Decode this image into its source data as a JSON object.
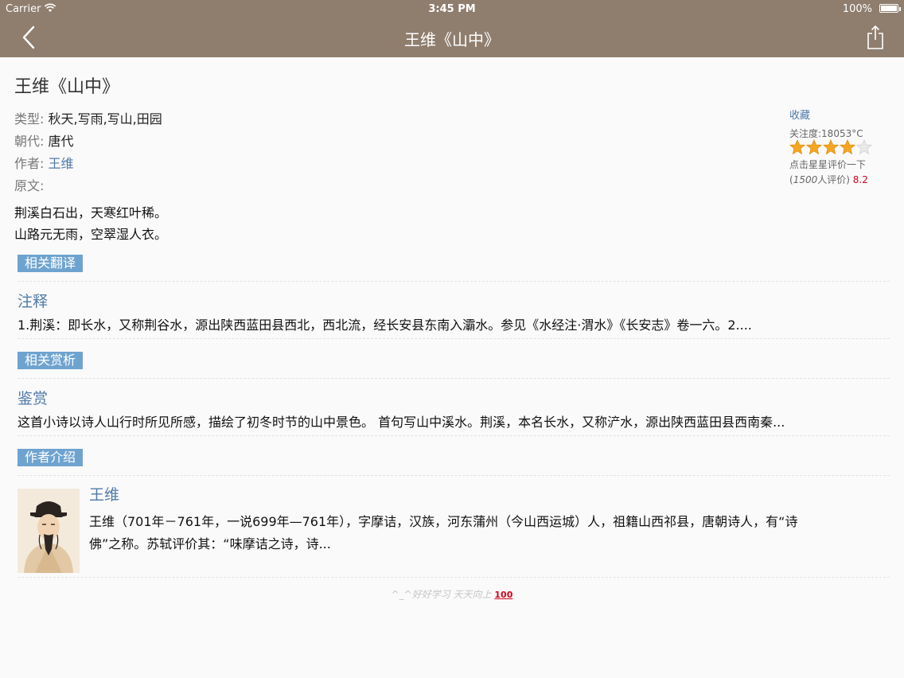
{
  "status_bar": {
    "carrier": "Carrier",
    "time": "3:45 PM",
    "battery": "100%"
  },
  "nav": {
    "title": "王维《山中》"
  },
  "poem": {
    "title": "王维《山中》",
    "type_label": "类型:",
    "type_value": "秋天,写雨,写山,田园",
    "dynasty_label": "朝代:",
    "dynasty_value": "唐代",
    "author_label": "作者:",
    "author_value": "王维",
    "text_label": "原文:",
    "lines": [
      "荆溪白石出，天寒红叶稀。",
      "山路元无雨，空翠湿人衣。"
    ]
  },
  "side": {
    "favorite": "收藏",
    "attention": "关注度:18053°C",
    "rating": 4,
    "rating_max": 5,
    "rate_prompt": "点击星星评价一下",
    "rating_count_open": "(",
    "rating_count": "1500",
    "rating_count_suffix": "人评价)",
    "score": "8.2",
    "star_color": "#f5a623"
  },
  "sections": {
    "translation_tag": "相关翻译",
    "notes_title": "注释",
    "notes_body": "1.荆溪：即长水，又称荆谷水，源出陕西蓝田县西北，西北流，经长安县东南入灞水。参见《水经注·渭水》《长安志》卷一六。2....",
    "appreciation_tag": "相关赏析",
    "appreciation_title": "鉴赏",
    "appreciation_body": "这首小诗以诗人山行时所见所感，描绘了初冬时节的山中景色。 首句写山中溪水。荆溪，本名长水，又称浐水，源出陕西蓝田县西南秦...",
    "author_tag": "作者介绍",
    "author_name": "王维",
    "author_line1": "王维（701年－761年，一说699年—761年），字摩诘，汉族，河东蒲州（今山西运城）人，祖籍山西祁县，唐朝诗人，有“诗",
    "author_line2": "佛”之称。苏轼评价其：“味摩诘之诗，诗..."
  },
  "footer": {
    "text": "^_^好好学习 天天向上",
    "emoji": "100"
  },
  "colors": {
    "nav_bg": "#8f7e6e",
    "link": "#4f79a8",
    "tag_bg": "#6fa3cf",
    "score": "#d0021b"
  }
}
